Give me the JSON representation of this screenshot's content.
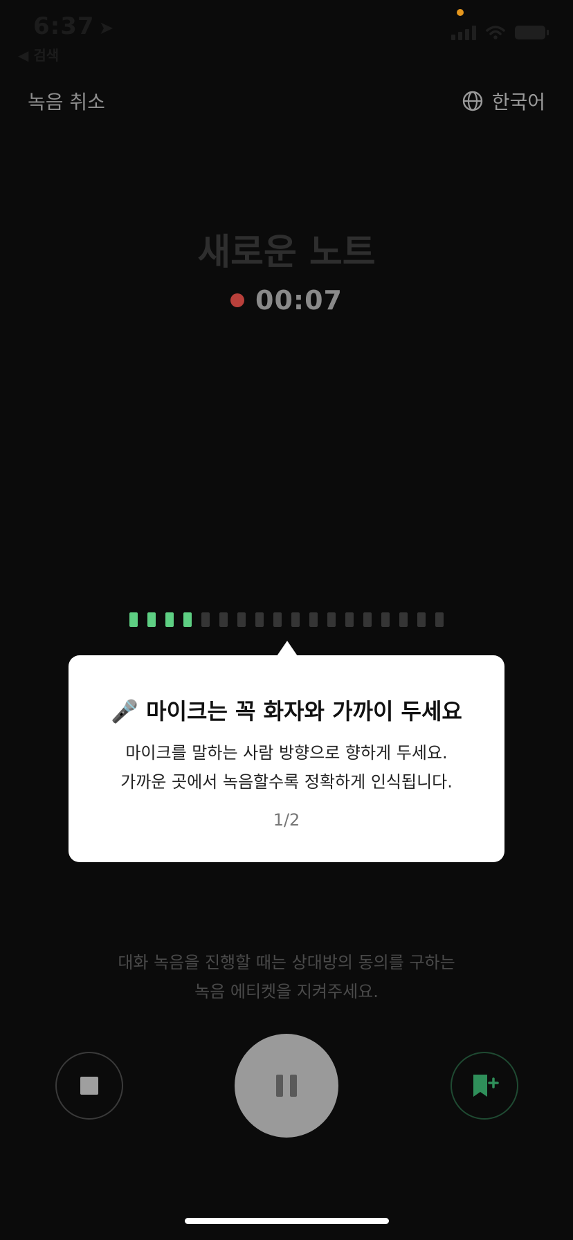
{
  "status_bar": {
    "time": "6:37",
    "back_label": "◀ 검색",
    "signal_bars": 4,
    "colors": {
      "privacy_dot": "#e5961d"
    }
  },
  "header": {
    "cancel_label": "녹음 취소",
    "language_label": "한국어",
    "globe_icon": "globe-icon"
  },
  "note": {
    "title": "새로운 노트",
    "timer": "00:07",
    "recording_dot_color": "#b9403b"
  },
  "level_meter": {
    "total_segments": 18,
    "active_segments": 4,
    "active_color": "#5ecf83",
    "inactive_color": "#353535"
  },
  "tooltip": {
    "title": "🎤 마이크는 꼭 화자와 가까이 두세요",
    "line1": "마이크를 말하는 사람 방향으로 향하게 두세요.",
    "line2": "가까운 곳에서 녹음할수록 정확하게 인식됩니다.",
    "page": "1/2"
  },
  "etiquette": {
    "line1": "대화 녹음을 진행할 때는 상대방의 동의를 구하는",
    "line2": "녹음 에티켓을 지켜주세요."
  },
  "controls": {
    "stop_icon": "stop-icon",
    "pause_icon": "pause-icon",
    "bookmark_icon": "bookmark-add-icon",
    "bookmark_color": "#2f8f5a"
  }
}
